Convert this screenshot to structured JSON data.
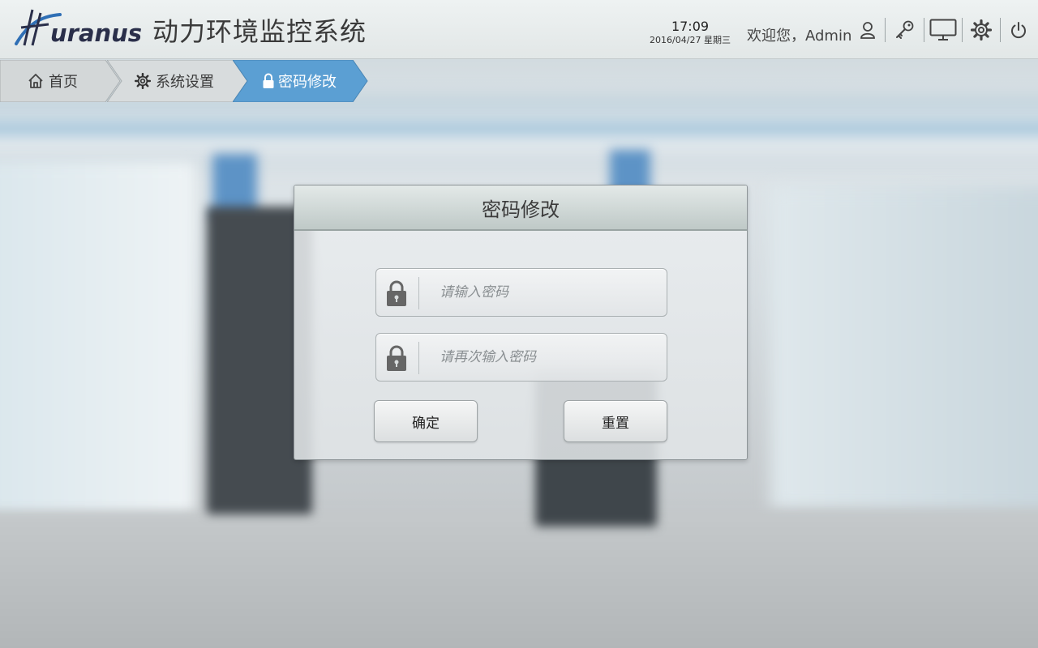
{
  "app": {
    "logo_text": "uranus",
    "title": "动力环境监控系统"
  },
  "header": {
    "time": "17:09",
    "date": "2016/04/27 星期三",
    "welcome": "欢迎您，Admin",
    "icons": [
      "user-icon",
      "key-icon",
      "monitor-icon",
      "gear-icon",
      "power-icon"
    ]
  },
  "breadcrumb": [
    {
      "label": "首页",
      "icon": "home-icon"
    },
    {
      "label": "系统设置",
      "icon": "gear-icon"
    },
    {
      "label": "密码修改",
      "icon": "lock-icon",
      "active": true
    }
  ],
  "dialog": {
    "title": "密码修改",
    "password_placeholder": "请输入密码",
    "confirm_placeholder": "请再次输入密码",
    "confirm_button": "确定",
    "reset_button": "重置"
  },
  "colors": {
    "active_crumb": "#5b9fd3",
    "header_bg": "#e6eaea",
    "dialog_header": "#c9d2d0"
  }
}
